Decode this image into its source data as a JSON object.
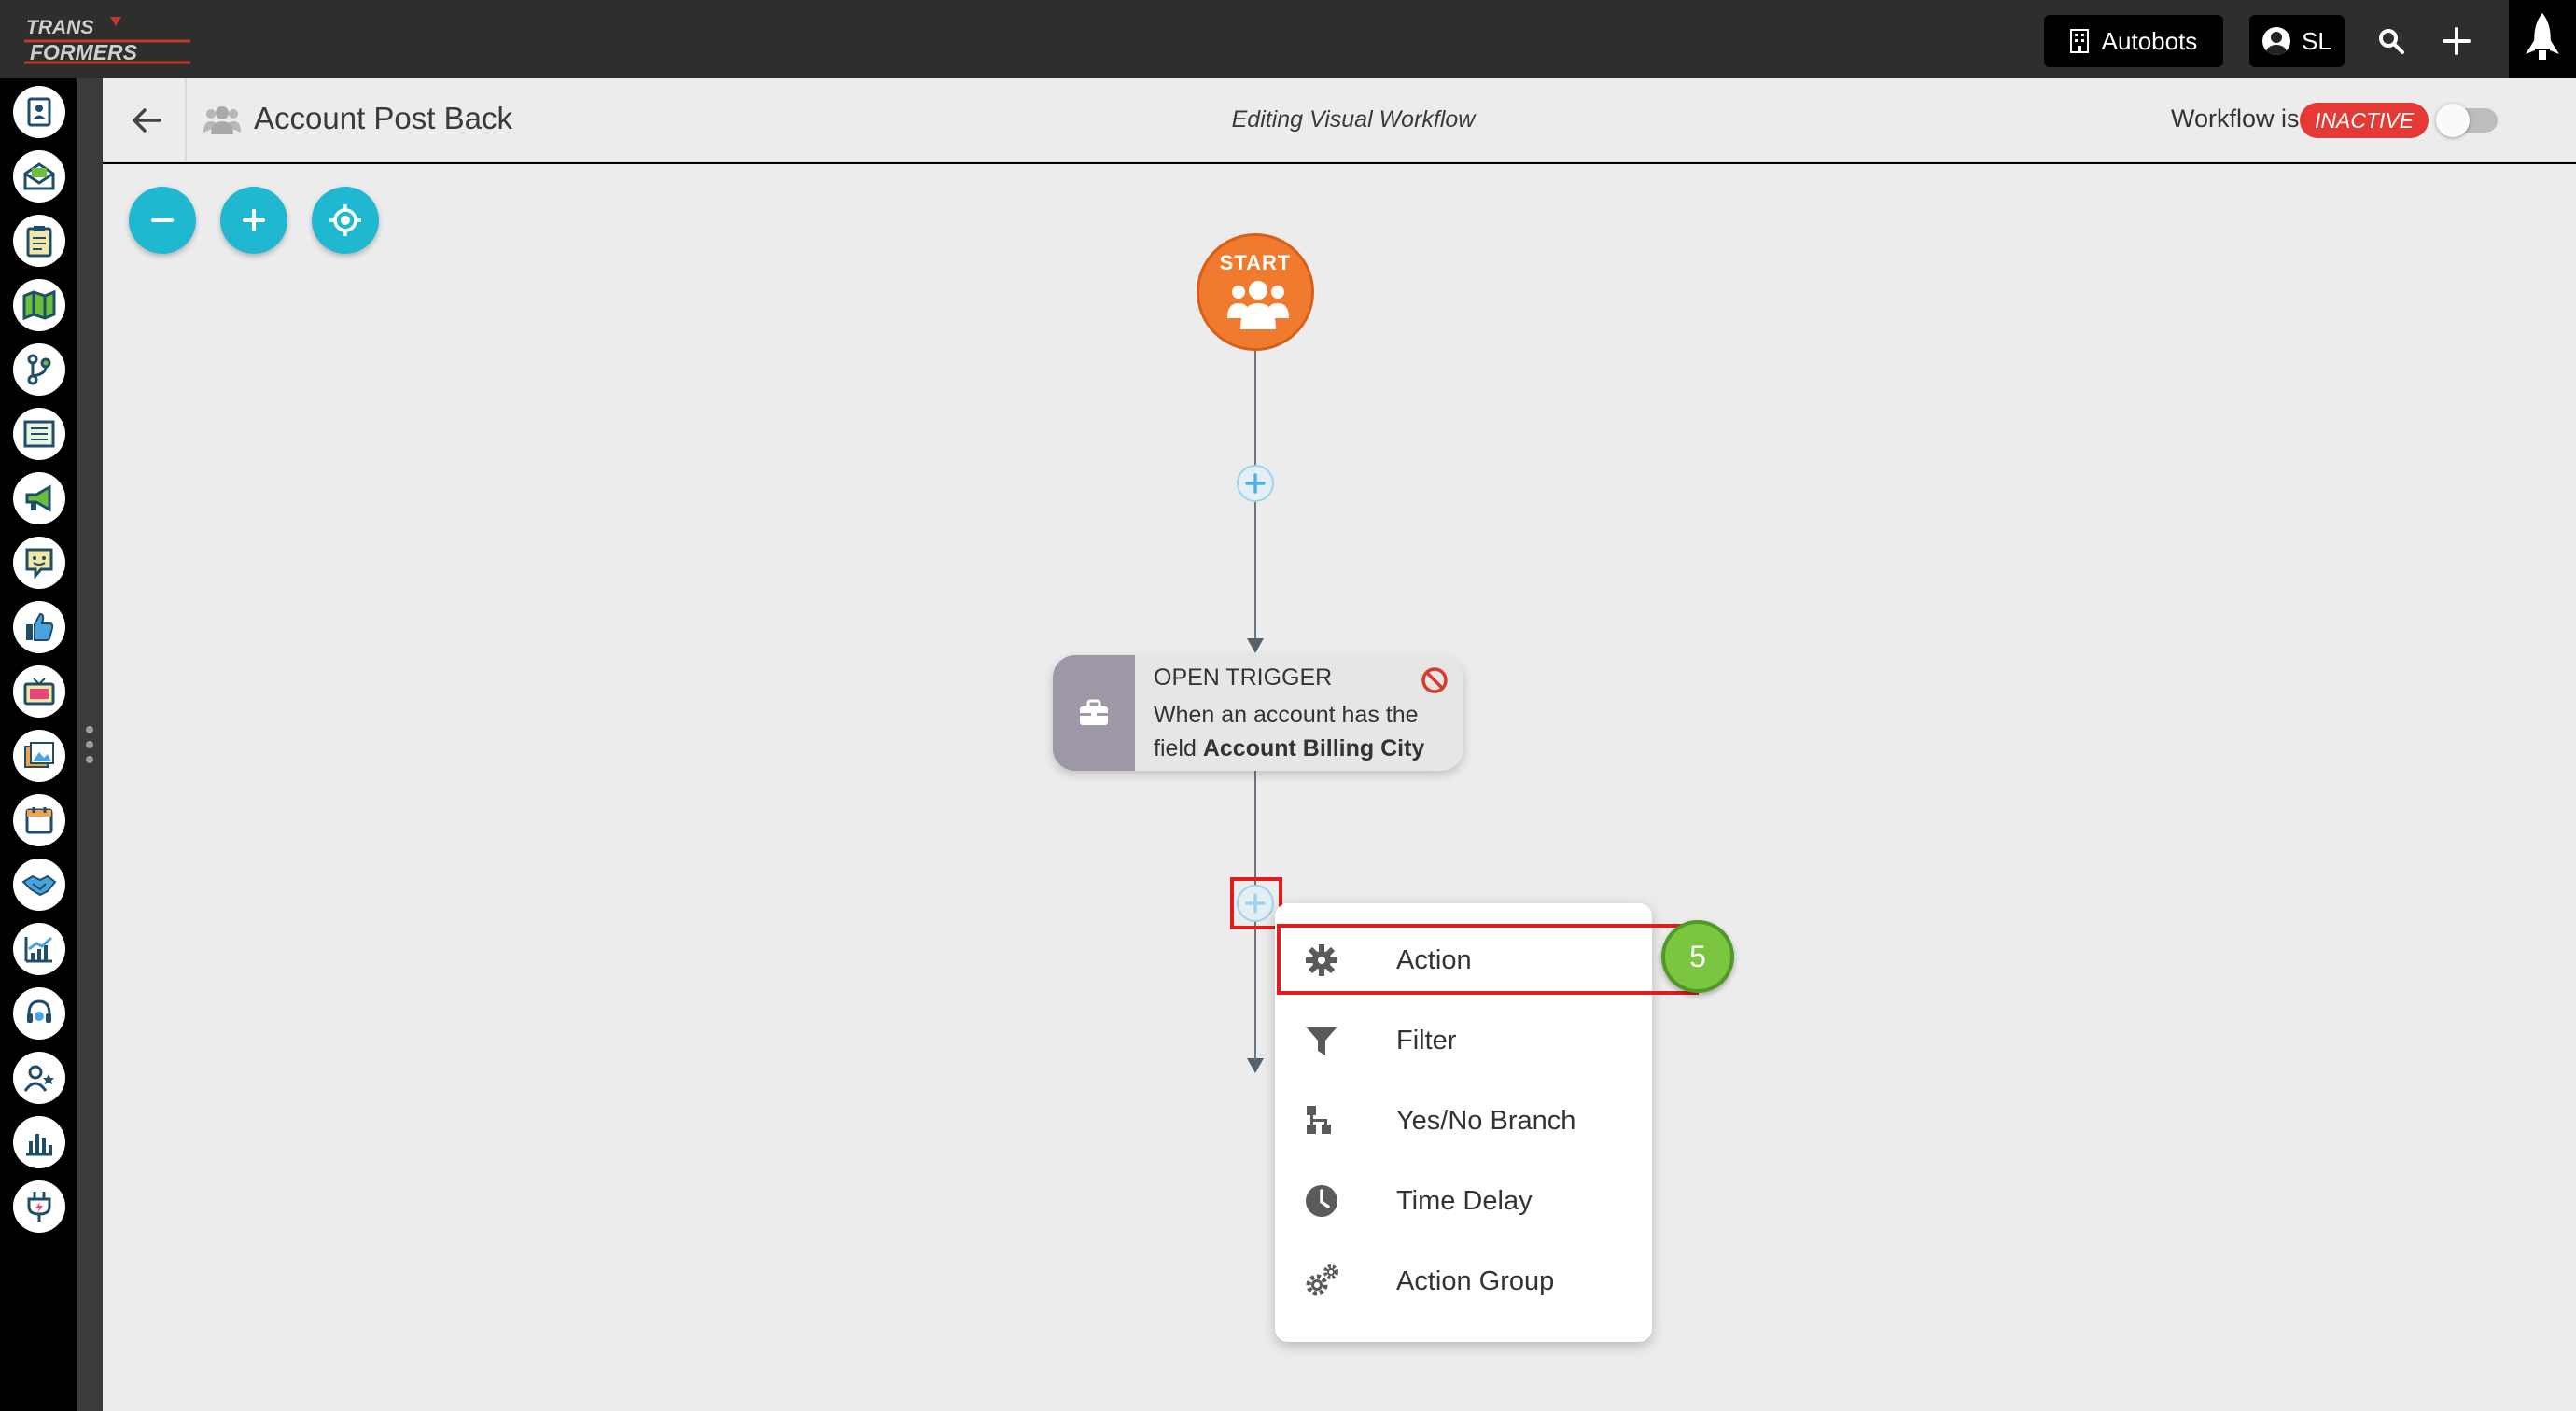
{
  "topbar": {
    "logo_text_1": "TRANS",
    "logo_text_2": "FORMERS",
    "org_button": "Autobots",
    "user_initials": "SL"
  },
  "header": {
    "title": "Account Post Back",
    "editing_label": "Editing Visual Workflow",
    "status_prefix": "Workflow is",
    "status_badge": "INACTIVE"
  },
  "canvas": {
    "start_label": "START",
    "trigger": {
      "title": "OPEN TRIGGER",
      "body_prefix": "When an account has the field",
      "body_field": "Account Billing City"
    }
  },
  "menu": {
    "items": [
      {
        "label": "Action",
        "icon": "gear-icon"
      },
      {
        "label": "Filter",
        "icon": "filter-icon"
      },
      {
        "label": "Yes/No Branch",
        "icon": "branch-icon"
      },
      {
        "label": "Time Delay",
        "icon": "clock-icon"
      },
      {
        "label": "Action Group",
        "icon": "gears-icon"
      }
    ]
  },
  "step_badge": "5",
  "colors": {
    "accent": "#20b8d0",
    "start_node": "#f07a2e",
    "inactive": "#e53935",
    "highlight": "#e01c1c",
    "step_badge": "#7cc540"
  }
}
